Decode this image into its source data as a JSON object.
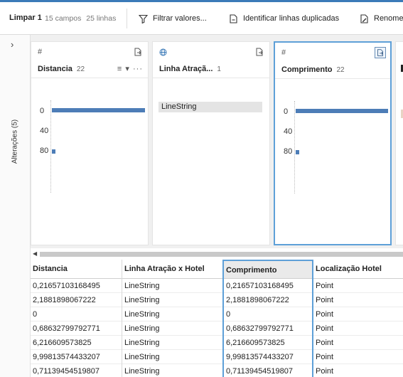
{
  "toolbar": {
    "step_name": "Limpar 1",
    "fields": "15 campos",
    "rows": "25 linhas",
    "filter_label": "Filtrar valores...",
    "duplicates_label": "Identificar linhas duplicadas",
    "rename_label": "Renomea"
  },
  "rail": {
    "label": "Alterações (5)"
  },
  "cards": [
    {
      "type_icon": "#",
      "title": "Distancia",
      "count": "22",
      "ticks": [
        "0",
        "40",
        "80"
      ]
    },
    {
      "type_icon": "globe",
      "title": "Linha Atraçã...",
      "count": "1",
      "value": "LineString"
    },
    {
      "type_icon": "#",
      "title": "Comprimento",
      "count": "22",
      "ticks": [
        "0",
        "40",
        "80"
      ]
    }
  ],
  "grid": {
    "columns": [
      "Distancia",
      "Linha Atração x Hotel",
      "Comprimento",
      "Localização Hotel"
    ],
    "rows": [
      [
        "0,21657103168495",
        "LineString",
        "0,21657103168495",
        "Point"
      ],
      [
        "2,1881898067222",
        "LineString",
        "2,1881898067222",
        "Point"
      ],
      [
        "0",
        "LineString",
        "0",
        "Point"
      ],
      [
        "0,68632799792771",
        "LineString",
        "0,68632799792771",
        "Point"
      ],
      [
        "6,216609573825",
        "LineString",
        "6,216609573825",
        "Point"
      ],
      [
        "9,99813574433207",
        "LineString",
        "9,99813574433207",
        "Point"
      ],
      [
        "0,71139454519807",
        "LineString",
        "0,71139454519807",
        "Point"
      ]
    ]
  },
  "colors": {
    "accent": "#3b7ab8",
    "bar": "#4d7db7",
    "selection": "#5ea0d8"
  }
}
